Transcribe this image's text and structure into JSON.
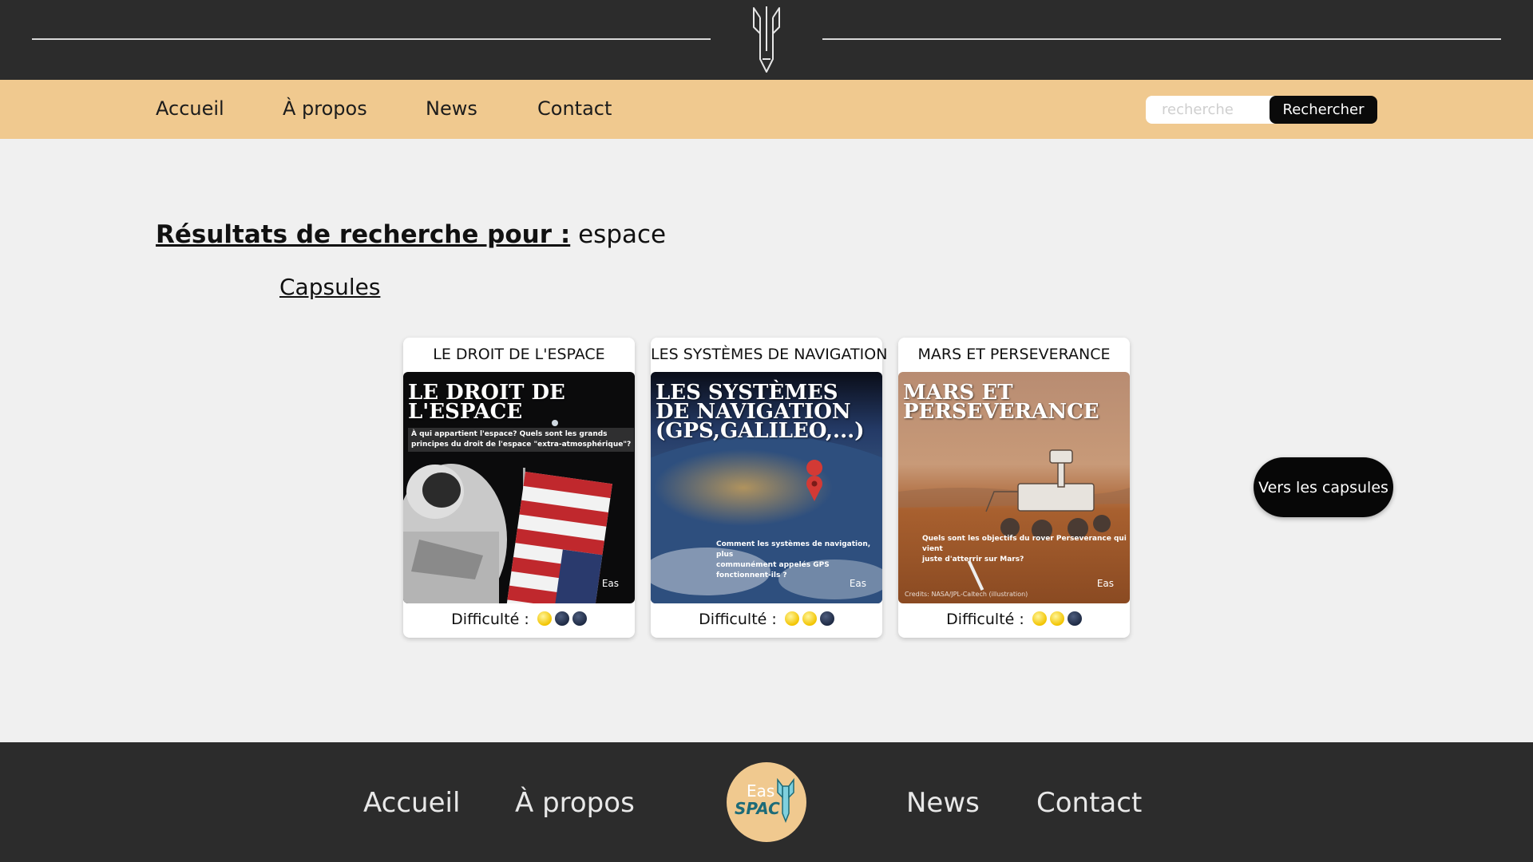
{
  "header": {
    "logo_icon": "rocket-icon"
  },
  "nav": {
    "items": [
      {
        "label": "Accueil"
      },
      {
        "label": "À propos"
      },
      {
        "label": "News"
      },
      {
        "label": "Contact"
      }
    ],
    "search": {
      "placeholder": "recherche",
      "value": "",
      "button_label": "Rechercher"
    }
  },
  "main": {
    "results_label": "Résultats de recherche pour :",
    "query": "espace",
    "section_title": "Capsules",
    "difficulty_label": "Difficulté :",
    "cards": [
      {
        "title": "LE DROIT DE L'ESPACE",
        "image_title": [
          "LE DROIT DE",
          "L'ESPACE"
        ],
        "image_subtitle": [
          "À qui appartient l'espace? Quels sont les grands",
          "principes du droit de l'espace \"extra-atmosphérique\"?"
        ],
        "image_brand": "Eas",
        "difficulty": 1,
        "difficulty_max": 3
      },
      {
        "title": "LES SYSTÈMES DE NAVIGATION",
        "image_title": [
          "LES SYSTÈMES",
          "DE NAVIGATION",
          "(GPS,GALILEO,...)"
        ],
        "image_subtitle": [
          "Comment les systèmes de navigation, plus",
          "communément appelés GPS fonctionnent-ils ?"
        ],
        "image_brand": "Eas",
        "difficulty": 2,
        "difficulty_max": 3
      },
      {
        "title": "MARS ET PERSEVERANCE",
        "image_title": [
          "MARS ET",
          "PERSEVERANCE"
        ],
        "image_subtitle": [
          "Quels sont les objectifs du rover Perseverance qui vient",
          "juste d'atterrir sur Mars?"
        ],
        "image_credit": "Credits: NASA/JPL-Caltech (illustration)",
        "image_brand": "Eas",
        "difficulty": 2,
        "difficulty_max": 3
      }
    ],
    "cta_label": "Vers les capsules"
  },
  "footer": {
    "links": [
      {
        "label": "Accueil"
      },
      {
        "label": "À propos"
      },
      {
        "label": "News"
      },
      {
        "label": "Contact"
      }
    ],
    "logo_text_1": "Eas",
    "logo_text_2": "SPAC"
  },
  "colors": {
    "header_bg": "#2c2c2c",
    "nav_bg": "#f0c98f",
    "page_bg": "#f0f0f0",
    "difficulty_on": "#f2c400",
    "difficulty_off": "#1e2a44"
  }
}
